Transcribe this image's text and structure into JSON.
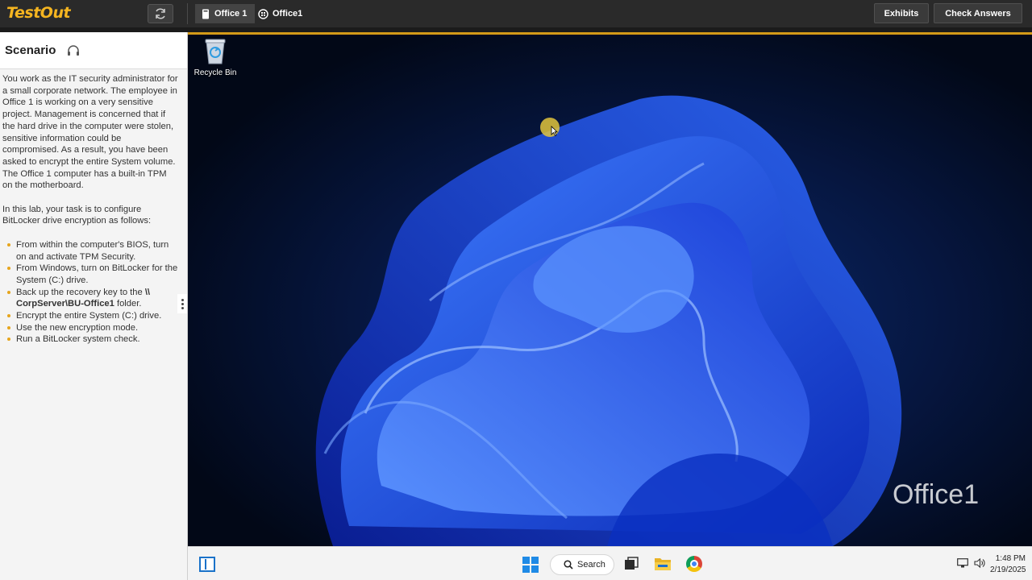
{
  "app": {
    "logo": "TestOut",
    "breadcrumbs": [
      "Office 1",
      "Office1"
    ],
    "buttons": {
      "exhibits": "Exhibits",
      "check_answers": "Check Answers"
    }
  },
  "scenario": {
    "title": "Scenario",
    "paragraphs": [
      "You work as the IT security administrator for a small corporate network. The employee in Office 1 is working on a very sensitive project. Management is concerned that if the hard drive in the computer were stolen, sensitive information could be compromised. As a result, you have been asked to encrypt the entire System volume. The Office 1 computer has a built-in TPM on the motherboard.",
      "In this lab, your task is to configure BitLocker drive encryption as follows:"
    ],
    "tasks": [
      {
        "text": "From within the computer's BIOS, turn on and activate TPM Security."
      },
      {
        "text": "From Windows, turn on BitLocker for the System (C:) drive."
      },
      {
        "pre": "Back up the recovery key to the ",
        "bold": "\\\\ CorpServer\\BU-Office1",
        "post": " folder."
      },
      {
        "text": "Encrypt the entire System (C:) drive."
      },
      {
        "text": "Use the new encryption mode."
      },
      {
        "text": "Run a BitLocker system check."
      }
    ]
  },
  "desktop": {
    "icons": [
      {
        "label": "Recycle Bin",
        "icon": "recycle-bin-icon"
      }
    ],
    "watermark": "Office1"
  },
  "taskbar": {
    "search_label": "Search",
    "time": "1:48 PM",
    "date": "2/19/2025"
  },
  "colors": {
    "accent": "#f5b520",
    "accent_line": "#d49a18",
    "windows_blue": "#1f8ae6"
  }
}
